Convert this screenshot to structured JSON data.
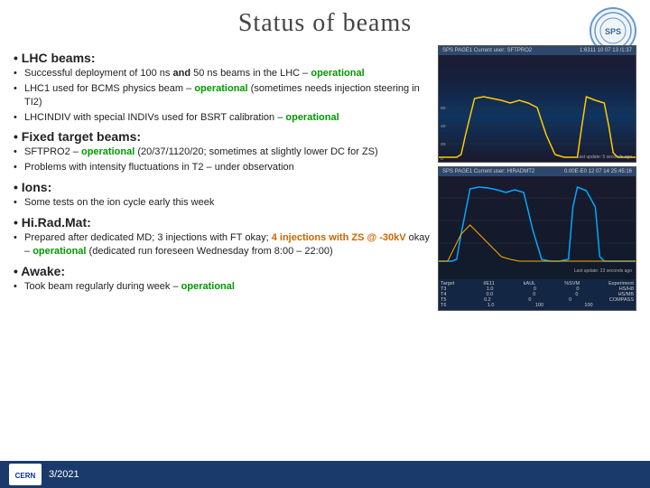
{
  "header": {
    "title": "Status of beams",
    "logo_text": "SPS"
  },
  "sections": [
    {
      "id": "lhc",
      "heading": "LHC beams:",
      "items": [
        {
          "text_before": "Successful deployment of 100 ns",
          "text_bold_and": "and",
          "text_mid": " 50 ns beams in the LHC –",
          "status": "operational",
          "status_color": "green"
        },
        {
          "text": "LHC1 used for BCMS physics beam –",
          "status": "operational",
          "status_color": "green",
          "text_after": " (sometimes needs injection steering in TI2)"
        },
        {
          "text": "LHCINDIV with special INDIVs used for BSRT calibration –",
          "status": "operational",
          "status_color": "green"
        }
      ]
    },
    {
      "id": "fixed",
      "heading": "Fixed target beams:",
      "items": [
        {
          "text": "SFTPRO2 –",
          "status": "operational",
          "status_color": "green",
          "text_after": " (20/37/1120/20; sometimes at slightly lower DC for ZS)"
        },
        {
          "text": "Problems with intensity fluctuations in T2 – under observation"
        }
      ]
    },
    {
      "id": "ions",
      "heading": "Ions:",
      "items": [
        {
          "text": "Some tests on the ion cycle early this week"
        }
      ]
    },
    {
      "id": "hiradmat",
      "heading": "Hi.Rad.Mat:",
      "items": [
        {
          "text": "Prepared after dedicated MD; 3 injections with FT okay;",
          "highlight": "4 injections with ZS @ -30kV",
          "highlight_color": "orange",
          "text_mid": " okay –",
          "status": "operational",
          "status_color": "green",
          "text_after": " (dedicated run foreseen Wednesday from 8:00 – 22:00)"
        }
      ]
    },
    {
      "id": "awake",
      "heading": "Awake:",
      "items": [
        {
          "text": "Took beam regularly during week –",
          "status": "operational",
          "status_color": "green"
        }
      ]
    }
  ],
  "screenshot1": {
    "top_label": "SPS PAGE1  Current user: SFTPRO2",
    "time": "1:6311 10 07 13 /1:37",
    "update": "Last update: 5 seconds ago"
  },
  "screenshot2": {
    "top_label": "SPS PAGE1  Current user: HIRADMT2",
    "time": "0.00E-E0 12 07 14 25:45:16",
    "update": "Last update: 23 seconds ago",
    "table_rows": [
      {
        "label": "Target 1",
        "v1": "I/E11",
        "v2": "kAUL",
        "v3": "%SVM",
        "v4": "Experiment"
      },
      {
        "label": "T3",
        "v1": "1.0",
        "v2": "0",
        "v3": "0",
        "v4": "HS/HB"
      },
      {
        "label": "T4",
        "v1": "0.0",
        "v2": "0",
        "v3": "0",
        "v4": "HS/MB"
      },
      {
        "label": "T5",
        "v1": "0.2",
        "v2": "0",
        "v3": "0",
        "v4": "COMPASS"
      },
      {
        "label": "T6",
        "v1": "1.0",
        "v2": "100",
        "v3": "100",
        "v4": ""
      }
    ]
  },
  "footer": {
    "logo_text": "CERN",
    "date": "3/2021"
  }
}
